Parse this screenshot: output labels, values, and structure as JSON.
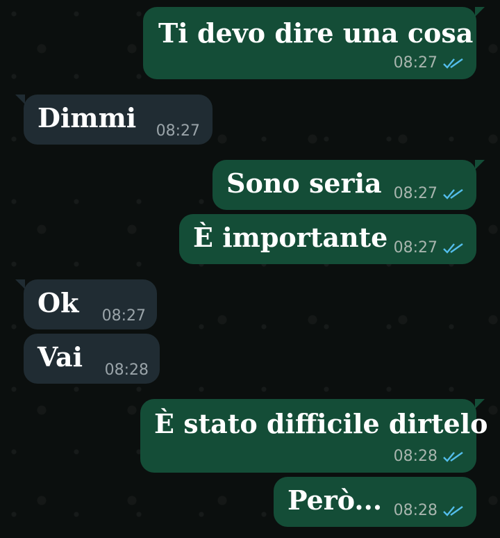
{
  "chat": {
    "messages": [
      {
        "direction": "out",
        "text": "Ti devo dire una cosa",
        "time": "08:27",
        "status": "read"
      },
      {
        "direction": "in",
        "text": "Dimmi",
        "time": "08:27"
      },
      {
        "direction": "out",
        "text": "Sono seria",
        "time": "08:27",
        "status": "read"
      },
      {
        "direction": "out",
        "text": "È importante",
        "time": "08:27",
        "status": "read"
      },
      {
        "direction": "in",
        "text": "Ok",
        "time": "08:27"
      },
      {
        "direction": "in",
        "text": "Vai",
        "time": "08:28"
      },
      {
        "direction": "out",
        "text": "È stato difficile dirtelo",
        "time": "08:28",
        "status": "read"
      },
      {
        "direction": "out",
        "text": "Però...",
        "time": "08:28",
        "status": "read"
      }
    ]
  },
  "colors": {
    "background": "#0b0f0e",
    "outgoing_bubble": "#144d37",
    "incoming_bubble": "#202c33",
    "read_ticks": "#53bdeb"
  },
  "icons": {
    "read_receipt": "double-check-icon"
  }
}
